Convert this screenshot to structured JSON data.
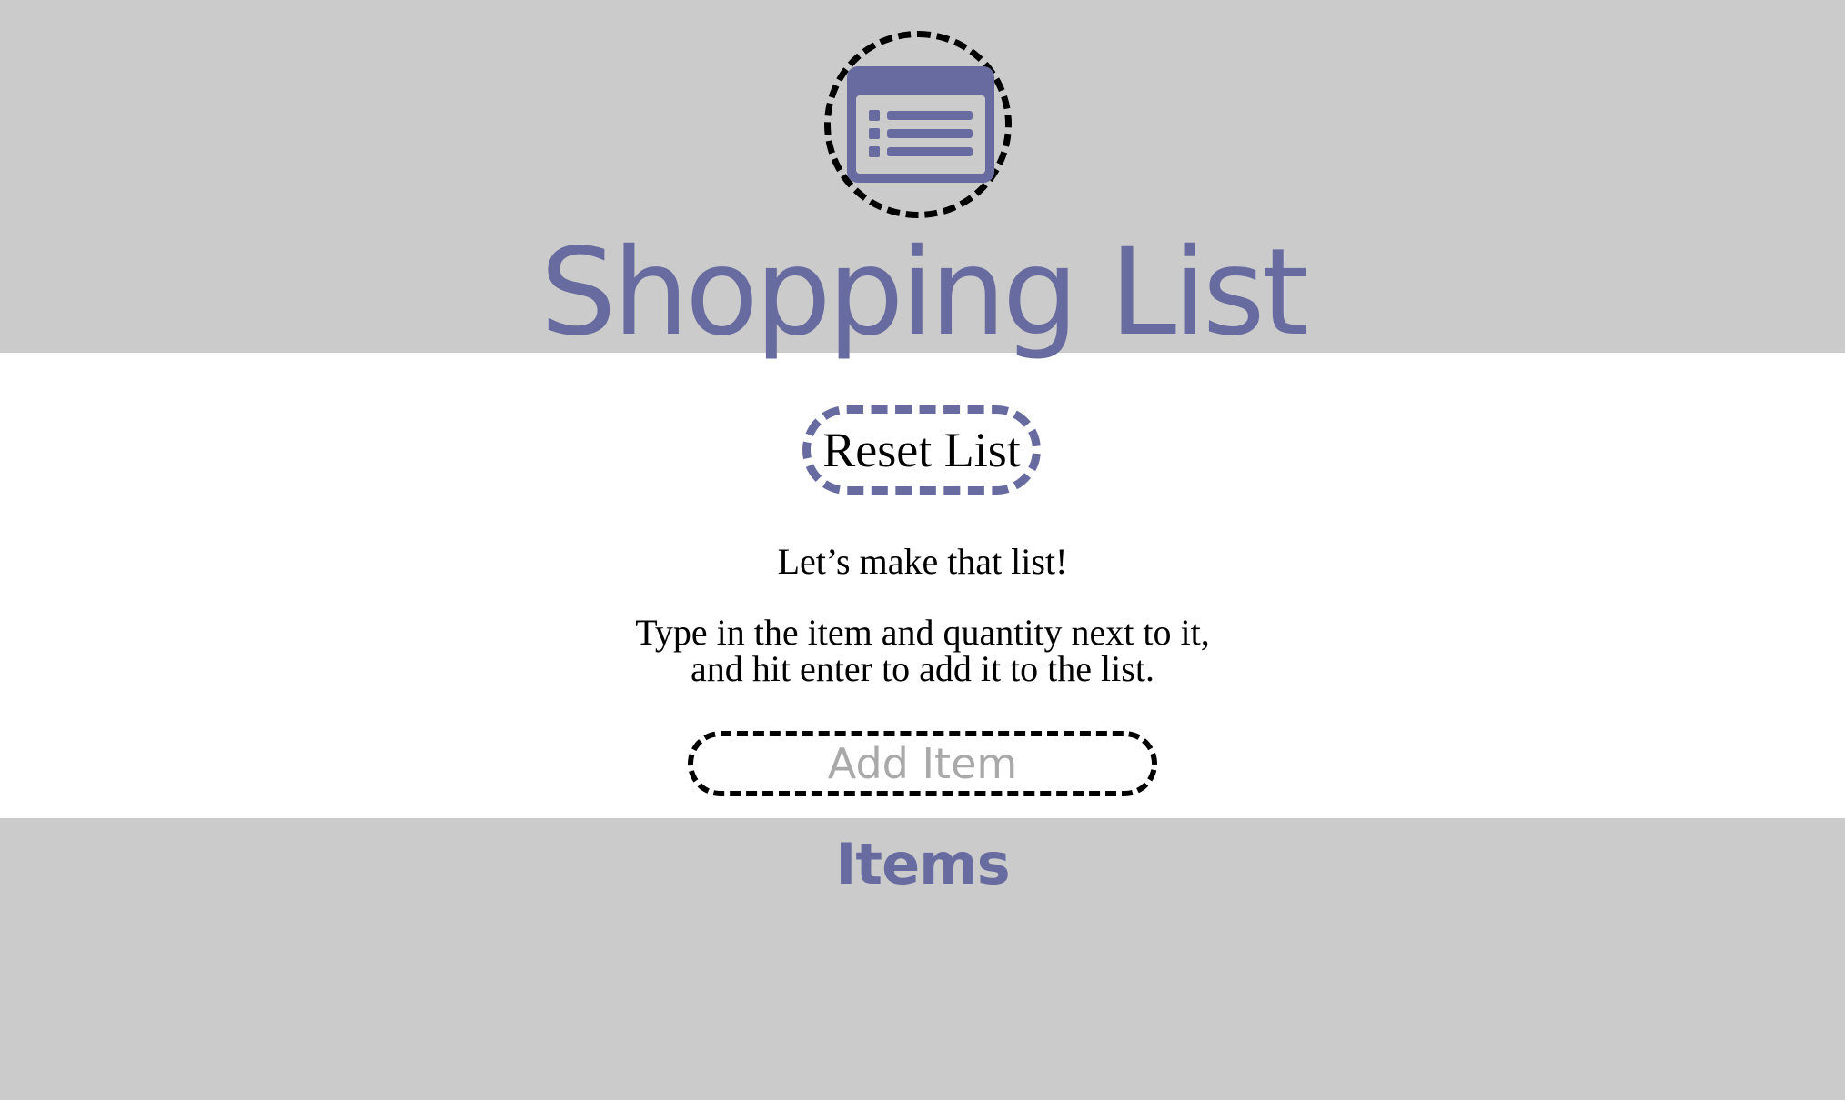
{
  "header": {
    "logo_icon": "list-window-icon",
    "title": "Shopping List"
  },
  "controls": {
    "reset_label": "Reset List"
  },
  "instructions": {
    "intro": "Let’s make that list!",
    "line1": "Type in the item and quantity next to it,",
    "line2": "and hit enter to add it to the list."
  },
  "add_item": {
    "placeholder": "Add Item",
    "value": ""
  },
  "items_section": {
    "heading": "Items",
    "items": []
  },
  "colors": {
    "accent": "#686b9f",
    "band": "#cbcbcb",
    "content_bg": "#ffffff",
    "placeholder": "#a9a9a9"
  }
}
